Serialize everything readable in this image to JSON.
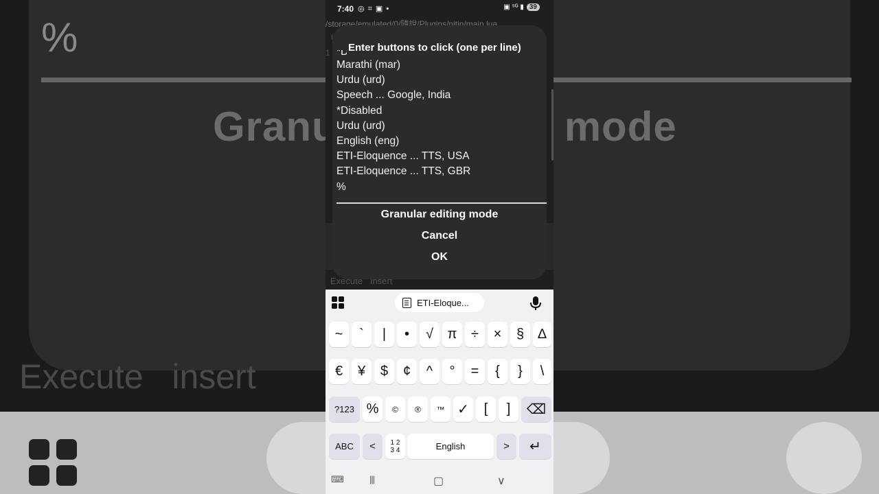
{
  "background": {
    "percent": "%",
    "title_left": "Granu",
    "title_right": "mode",
    "execute": "Execute",
    "insert": "insert"
  },
  "status_bar": {
    "time": "7:40",
    "left_icons": "◎ ⌗ ▣ •",
    "right_icons": "▣ ⁵ᴳ ▮",
    "battery": "39"
  },
  "app": {
    "path": "/storage/emulated/0/隨說/Plugins/nitin/main.lua",
    "line1": "U",
    "line2": "1",
    "execute": "Execute",
    "insert": "Insert"
  },
  "dialog": {
    "title": "Enter buttons to click (one per line)",
    "lines": [
      "*Disabled",
      "Marathi (mar)",
      "Urdu (urd)",
      "Speech ... Google, India",
      "*Disabled",
      "Urdu (urd)",
      "English (eng)",
      "ETI-Eloquence ... TTS, USA",
      "ETI-Eloquence ... TTS, GBR",
      "%"
    ],
    "granular_label": "Granular editing mode",
    "cancel_label": "Cancel",
    "ok_label": "OK"
  },
  "keyboard": {
    "clipboard_text": "ETI-Eloque...",
    "row1": [
      "~",
      "`",
      "|",
      "•",
      "√",
      "π",
      "÷",
      "×",
      "§",
      "∆"
    ],
    "row2": [
      "€",
      "¥",
      "$",
      "¢",
      "^",
      "°",
      "=",
      "{",
      "}",
      "\\"
    ],
    "row3_mode": "?123",
    "row3": [
      "%",
      "©",
      "®",
      "™",
      "✓",
      "[",
      "]"
    ],
    "abc_label": "ABC",
    "left_arrow": "<",
    "numpad_label": "1 2\n3 4",
    "space_label": "English",
    "right_arrow": ">",
    "backspace_icon": "⌫",
    "enter_icon": "↵"
  },
  "navbar": {
    "keyboard_icon": "⌨",
    "recents_icon": "|||",
    "home_icon": "▢",
    "back_icon": "∨"
  }
}
